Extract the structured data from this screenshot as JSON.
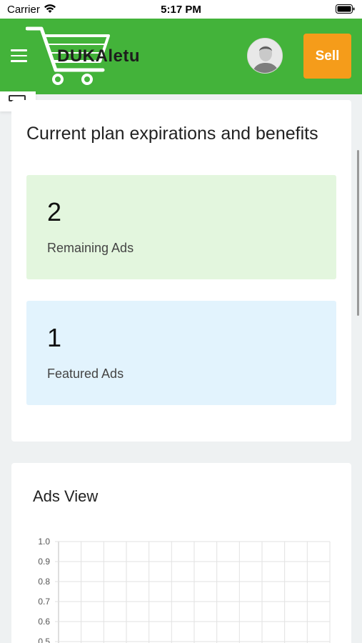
{
  "status_bar": {
    "carrier": "Carrier",
    "time": "5:17 PM"
  },
  "header": {
    "logo_text": "DUKAletu",
    "sell_label": "Sell",
    "brand_color": "#43b33a",
    "sell_color": "#f59c1a"
  },
  "plan": {
    "title": "Current plan expirations and benefits",
    "stats": [
      {
        "value": "2",
        "label": "Remaining Ads"
      },
      {
        "value": "1",
        "label": "Featured Ads"
      }
    ]
  },
  "chart_section": {
    "title": "Ads View"
  },
  "chart_data": {
    "type": "line",
    "title": "Ads View",
    "xlabel": "",
    "ylabel": "",
    "ylim": [
      0,
      1
    ],
    "yticks": [
      "1.0",
      "0.9",
      "0.8",
      "0.7",
      "0.6",
      "0.5"
    ],
    "vertical_gridlines": 12,
    "grid": true,
    "series": []
  }
}
